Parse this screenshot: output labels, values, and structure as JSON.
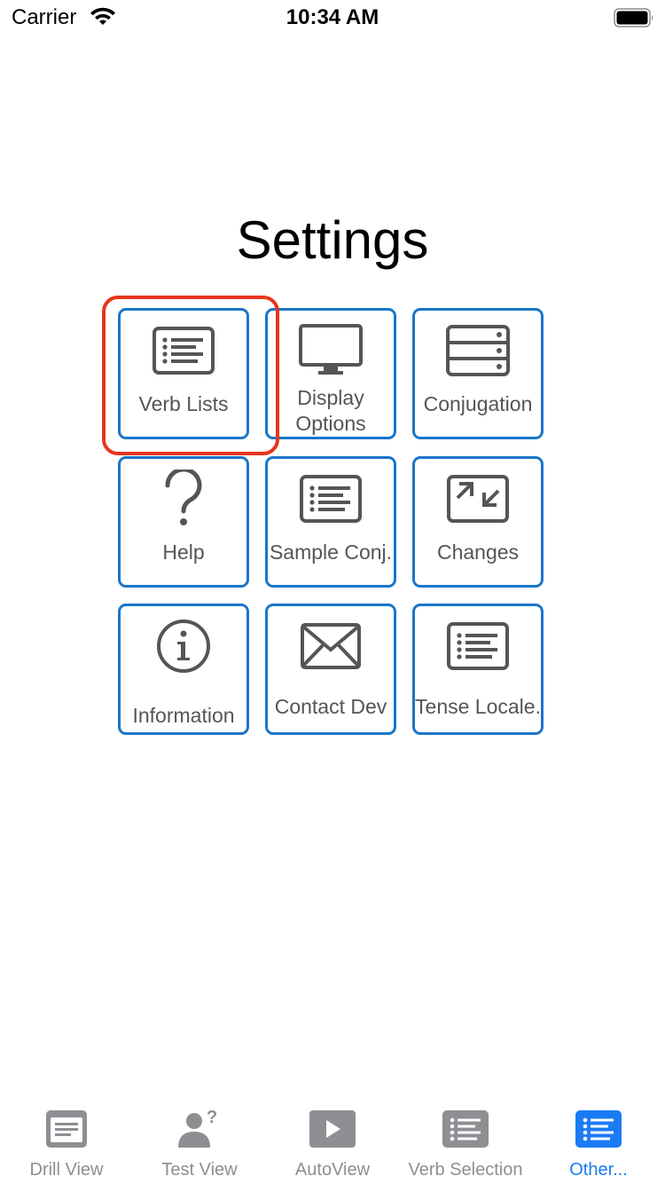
{
  "status_bar": {
    "carrier": "Carrier",
    "time": "10:34 AM"
  },
  "title": "Settings",
  "tiles": [
    {
      "label": "Verb Lists",
      "icon": "list-icon"
    },
    {
      "label": "Display Options",
      "icon": "monitor-icon"
    },
    {
      "label": "Conjugation",
      "icon": "server-rack-icon"
    },
    {
      "label": "Help",
      "icon": "question-mark-icon"
    },
    {
      "label": "Sample Conj.",
      "icon": "list-icon"
    },
    {
      "label": "Changes",
      "icon": "arrows-swap-icon"
    },
    {
      "label": "Information",
      "icon": "info-icon"
    },
    {
      "label": "Contact Dev",
      "icon": "envelope-icon"
    },
    {
      "label": "Tense Locale.",
      "icon": "list-icon"
    }
  ],
  "tab_bar": {
    "tabs": [
      {
        "label": "Drill View",
        "icon": "document-icon"
      },
      {
        "label": "Test View",
        "icon": "person-question-icon"
      },
      {
        "label": "AutoView",
        "icon": "play-icon"
      },
      {
        "label": "Verb Selection",
        "icon": "list-icon"
      },
      {
        "label": "Other...",
        "icon": "list-icon",
        "active": true
      }
    ]
  },
  "colors": {
    "tile_border": "#1a76c8",
    "tile_text": "#555555",
    "highlight": "#e8341c",
    "tab_active": "#1a7bf5",
    "tab_inactive": "#8e8e93"
  }
}
